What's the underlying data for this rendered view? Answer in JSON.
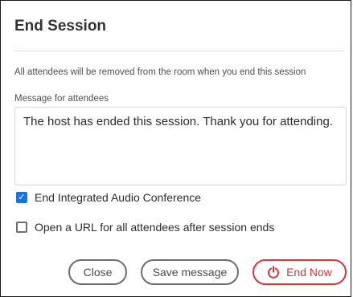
{
  "dialog": {
    "title": "End Session",
    "description": "All attendees will be removed from the room when you end this session",
    "message_label": "Message for attendees",
    "message_value": "The host has ended this session. Thank you for attending.",
    "options": [
      {
        "label": "End Integrated Audio Conference",
        "checked": true
      },
      {
        "label": "Open a URL for all attendees after session ends",
        "checked": false
      }
    ],
    "buttons": {
      "close": "Close",
      "save": "Save message",
      "end_now": "End Now"
    },
    "icons": {
      "end_now": "power-icon",
      "checkbox_checked": "checkmark-icon"
    },
    "colors": {
      "accent_blue": "#1473e6",
      "danger_red": "#d7373f",
      "button_border": "#6e6e6e"
    }
  }
}
